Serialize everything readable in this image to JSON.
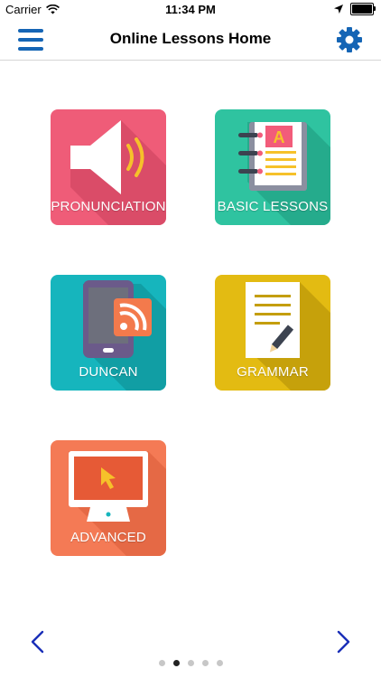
{
  "status_bar": {
    "carrier": "Carrier",
    "time": "11:34 PM",
    "icons": [
      "wifi-icon",
      "location-arrow-icon",
      "battery-icon"
    ]
  },
  "nav": {
    "title": "Online Lessons Home",
    "left_icon": "hamburger-menu-icon",
    "right_icon": "gear-icon",
    "accent_color": "#1565b5"
  },
  "tiles": [
    {
      "label": "PRONUNCIATION",
      "icon": "speaker-icon",
      "color": "#ef5c78"
    },
    {
      "label": "BASIC LESSONS",
      "icon": "notebook-icon",
      "color": "#2fc3a0"
    },
    {
      "label": "DUNCAN",
      "icon": "tablet-rss-icon",
      "color": "#16b5bd"
    },
    {
      "label": "GRAMMAR",
      "icon": "document-pencil-icon",
      "color": "#e3bb12"
    },
    {
      "label": "ADVANCED",
      "icon": "monitor-icon",
      "color": "#f47a55"
    }
  ],
  "pager": {
    "prev_icon": "chevron-left-icon",
    "next_icon": "chevron-right-icon",
    "page_count": 5,
    "current_page": 2
  }
}
